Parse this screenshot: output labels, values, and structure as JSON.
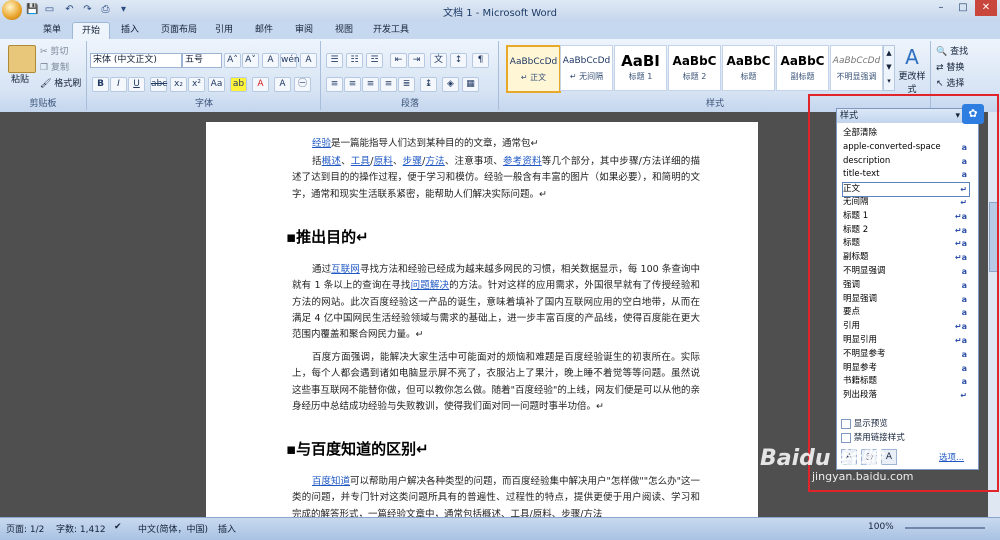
{
  "window": {
    "title": "文档 1 - Microsoft Word",
    "minimize": "–",
    "restore": "□",
    "close": "✕"
  },
  "tabs": [
    "菜单",
    "开始",
    "插入",
    "页面布局",
    "引用",
    "邮件",
    "审阅",
    "视图",
    "开发工具"
  ],
  "active_tab": "开始",
  "clipboard": {
    "paste": "粘贴",
    "cut": "剪切",
    "copy": "复制",
    "format_painter": "格式刷",
    "label": "剪贴板"
  },
  "font": {
    "font_name": "宋体 (中文正文)",
    "font_size": "五号",
    "label": "字体"
  },
  "paragraph": {
    "label": "段落"
  },
  "styles": {
    "label": "样式",
    "tiles": [
      {
        "sample": "AaBbCcDd",
        "name": "↵ 正文"
      },
      {
        "sample": "AaBbCcDd",
        "name": "↵ 无间隔"
      },
      {
        "sample": "AaBI",
        "name": "标题 1"
      },
      {
        "sample": "AaBbC",
        "name": "标题 2"
      },
      {
        "sample": "AaBbC",
        "name": "标题"
      },
      {
        "sample": "AaBbC",
        "name": "副标题"
      },
      {
        "sample": "AaBbCcDd",
        "name": "不明显强调"
      }
    ],
    "change_styles": "更改样式"
  },
  "editing": {
    "find": "查找",
    "replace": "替换",
    "select": "选择"
  },
  "document": {
    "p1": [
      "经验",
      "是一篇能指导人们达到某种目的的文章，通常包↵"
    ],
    "p2_parts": [
      "括",
      "概述",
      "、",
      "工具",
      "/",
      "原料",
      "、",
      "步骤",
      "/",
      "方法",
      "、注意事项、",
      "参考资料",
      "等几个部分，其中步骤/方法详细的描述了达到目的的操作过程，便于学习和模仿。经验一般含有丰富的图片（如果必要），和简明的文字，通常和现实生活联系紧密，能帮助人们解决实际问题。↵"
    ],
    "h1": "推出目的↵",
    "p3_parts": [
      "通过",
      "互联网",
      "寻找方法和经验已经成为越来越多网民的习惯，相关数据显示，每 100 条查询中就有 1 条以上的查询在寻找",
      "问题解决",
      "的方法。针对这样的应用需求，外国很早就有了传授经验和方法的网站。此次百度经验这一产品的诞生，意味着填补了国内互联网应用的空白地带，从而在满足 4 亿中国网民生活经验领域与需求的基础上，进一步丰富百度的产品线，使得百度能在更大范围内覆盖和聚合网民力量。↵"
    ],
    "p4": "百度方面强调，能解决大家生活中可能面对的烦恼和难题是百度经验诞生的初衷所在。实际上，每个人都会遇到诸如电脑显示屏不亮了，衣服沾上了果汁，晚上睡不着觉等等问题。虽然说这些事互联网不能替你做，但可以教你怎么做。随着\"百度经验\"的上线，网友们便是可以从他的亲身经历中总结成功经验与失败教训，使得我们面对同一问题时事半功倍。↵",
    "h2": "与百度知道的区别↵",
    "p5_parts": [
      "百度知道",
      "可以帮助用户解决各种类型的问题，而百度经验集中解决用户\"怎样做\"\"怎么办\"这一类的问题，并专门针对这类问题所具有的普遍性、过程性的特点，提供更便于用户阅读、学习和完成的解答形式，一篇经验文章中，通常包括概述、工具/原料、步骤/方法"
    ]
  },
  "styles_pane": {
    "title": "样式",
    "items": [
      {
        "name": "全部清除",
        "mark": ""
      },
      {
        "name": "apple-converted-space",
        "mark": "a"
      },
      {
        "name": "description",
        "mark": "a"
      },
      {
        "name": "title-text",
        "mark": "a"
      },
      {
        "name": "正文",
        "mark": "↵"
      },
      {
        "name": "无间隔",
        "mark": "↵"
      },
      {
        "name": "标题 1",
        "mark": "↵a"
      },
      {
        "name": "标题 2",
        "mark": "↵a"
      },
      {
        "name": "标题",
        "mark": "↵a"
      },
      {
        "name": "副标题",
        "mark": "↵a"
      },
      {
        "name": "不明显强调",
        "mark": "a"
      },
      {
        "name": "强调",
        "mark": "a"
      },
      {
        "name": "明显强调",
        "mark": "a"
      },
      {
        "name": "要点",
        "mark": "a"
      },
      {
        "name": "引用",
        "mark": "↵a"
      },
      {
        "name": "明显引用",
        "mark": "↵a"
      },
      {
        "name": "不明显参考",
        "mark": "a"
      },
      {
        "name": "明显参考",
        "mark": "a"
      },
      {
        "name": "书籍标题",
        "mark": "a"
      },
      {
        "name": "列出段落",
        "mark": "↵"
      }
    ],
    "selected": "正文",
    "show_preview": "显示预览",
    "disable_linked": "禁用链接样式",
    "options": "选项..."
  },
  "statusbar": {
    "page": "页面: 1/2",
    "words": "字数: 1,412",
    "lang": "中文(简体，中国)",
    "insert": "插入",
    "zoom": "100%"
  },
  "watermark": "Baidu 经验",
  "watermark_url": "jingyan.baidu.com",
  "colors": {
    "highlight_box": "#e0242a",
    "link": "#1f58c4"
  }
}
